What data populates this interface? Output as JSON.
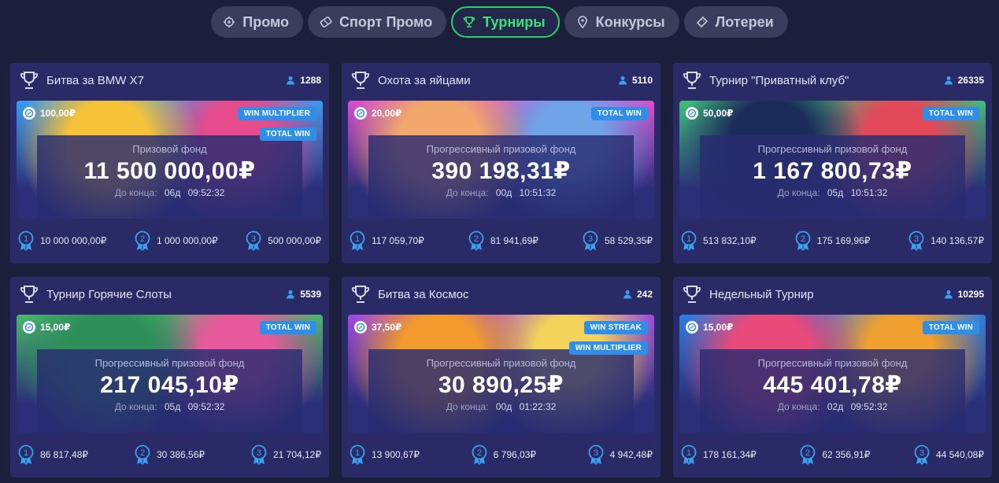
{
  "tabs": [
    {
      "label": "Промо",
      "icon": "gear-ticket-icon",
      "active": false
    },
    {
      "label": "Спорт Промо",
      "icon": "sport-ticket-icon",
      "active": false
    },
    {
      "label": "Турниры",
      "icon": "trophy-icon",
      "active": true
    },
    {
      "label": "Конкурсы",
      "icon": "map-pin-icon",
      "active": false
    },
    {
      "label": "Лотереи",
      "icon": "ticket-icon",
      "active": false
    }
  ],
  "cards": [
    {
      "title": "Битва за BMW X7",
      "players": "1288",
      "bet": "100,00₽",
      "badges": [
        "WIN MULTIPLIER",
        "TOTAL WIN"
      ],
      "fund_label": "Призовой фонд",
      "fund": "11 500 000,00₽",
      "timer_label": "До конца:",
      "days": "06д",
      "time": "09:52:32",
      "prizes": [
        "10 000 000,00₽",
        "1 000 000,00₽",
        "500 000,00₽"
      ],
      "art": [
        "#3a9bf0",
        "#f6c23a",
        "#e64b8c"
      ]
    },
    {
      "title": "Охота за яйцами",
      "players": "5110",
      "bet": "20,00₽",
      "badges": [
        "TOTAL WIN"
      ],
      "fund_label": "Прогрессивный призовой фонд",
      "fund": "390 198,31₽",
      "timer_label": "До конца:",
      "days": "00д",
      "time": "10:51:32",
      "prizes": [
        "117 059,70₽",
        "81 941,69₽",
        "58 529,35₽"
      ],
      "art": [
        "#d94fd0",
        "#f2a86b",
        "#6fa4e8"
      ]
    },
    {
      "title": "Турнир \"Приватный клуб\"",
      "players": "26335",
      "bet": "50,00₽",
      "badges": [
        "TOTAL WIN"
      ],
      "fund_label": "Прогрессивный призовой фонд",
      "fund": "1 167 800,73₽",
      "timer_label": "До конца:",
      "days": "05д",
      "time": "10:51:32",
      "prizes": [
        "513 832,10₽",
        "175 169,96₽",
        "140 136,57₽"
      ],
      "art": [
        "#3fbf7a",
        "#1c2c5a",
        "#e24a5a"
      ]
    },
    {
      "title": "Турнир Горячие Слоты",
      "players": "5539",
      "bet": "15,00₽",
      "badges": [
        "TOTAL WIN"
      ],
      "fund_label": "Прогрессивный призовой фонд",
      "fund": "217 045,10₽",
      "timer_label": "До конца:",
      "days": "05д",
      "time": "09:52:32",
      "prizes": [
        "86 817,48₽",
        "30 386,56₽",
        "21 704,12₽"
      ],
      "art": [
        "#46b96a",
        "#2e8f5a",
        "#e85a9b"
      ]
    },
    {
      "title": "Битва за Космос",
      "players": "242",
      "bet": "37,50₽",
      "badges": [
        "WIN STREAK",
        "WIN MULTIPLIER"
      ],
      "fund_label": "Прогрессивный призовой фонд",
      "fund": "30 890,25₽",
      "timer_label": "До конца:",
      "days": "00д",
      "time": "01:22:32",
      "prizes": [
        "13 900,67₽",
        "6 796,03₽",
        "4 942,48₽"
      ],
      "art": [
        "#a14be0",
        "#f29a2e",
        "#f4d35a"
      ]
    },
    {
      "title": "Недельный Турнир",
      "players": "10295",
      "bet": "15,00₽",
      "badges": [
        "TOTAL WIN"
      ],
      "fund_label": "Прогрессивный призовой фонд",
      "fund": "445 401,78₽",
      "timer_label": "До конца:",
      "days": "02д",
      "time": "09:52:32",
      "prizes": [
        "178 161,34₽",
        "62 356,91₽",
        "44 540,08₽"
      ],
      "art": [
        "#2f7de0",
        "#e84a7a",
        "#f0a030"
      ]
    }
  ],
  "colors": {
    "background": "#1b1f3b",
    "card": "#2a2a66",
    "active_tab": "#2ed06a",
    "badge": "#2f8fe8",
    "medal": "#3aa0f0"
  }
}
